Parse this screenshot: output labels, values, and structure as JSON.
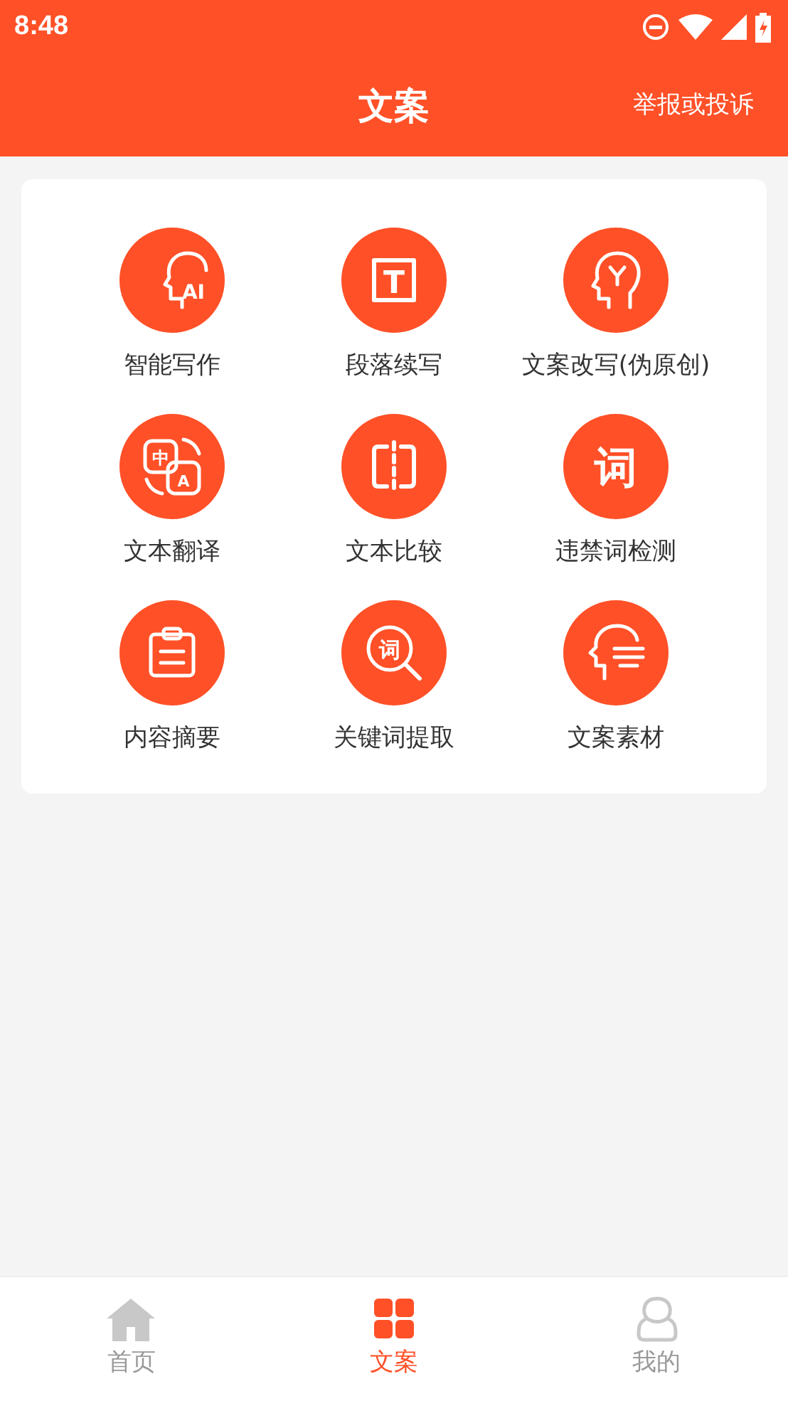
{
  "status_bar": {
    "time": "8:48"
  },
  "header": {
    "title": "文案",
    "action": "举报或投诉"
  },
  "tools": [
    {
      "label": "智能写作",
      "kind": "ai-head",
      "glyphs": [
        "AI"
      ]
    },
    {
      "label": "段落续写",
      "kind": "text-box",
      "glyphs": [
        "T"
      ]
    },
    {
      "label": "文案改写(伪原创)",
      "kind": "branch-head"
    },
    {
      "label": "文本翻译",
      "kind": "translate",
      "glyphs": [
        "中",
        "A"
      ]
    },
    {
      "label": "文本比较",
      "kind": "compare"
    },
    {
      "label": "违禁词检测",
      "kind": "word",
      "glyphs": [
        "词"
      ]
    },
    {
      "label": "内容摘要",
      "kind": "clipboard"
    },
    {
      "label": "关键词提取",
      "kind": "word-search",
      "glyphs": [
        "词"
      ]
    },
    {
      "label": "文案素材",
      "kind": "speak-head"
    }
  ],
  "tab_bar": [
    {
      "label": "首页",
      "kind": "home",
      "selected": false
    },
    {
      "label": "文案",
      "kind": "grid",
      "selected": true
    },
    {
      "label": "我的",
      "kind": "user",
      "selected": false
    }
  ]
}
